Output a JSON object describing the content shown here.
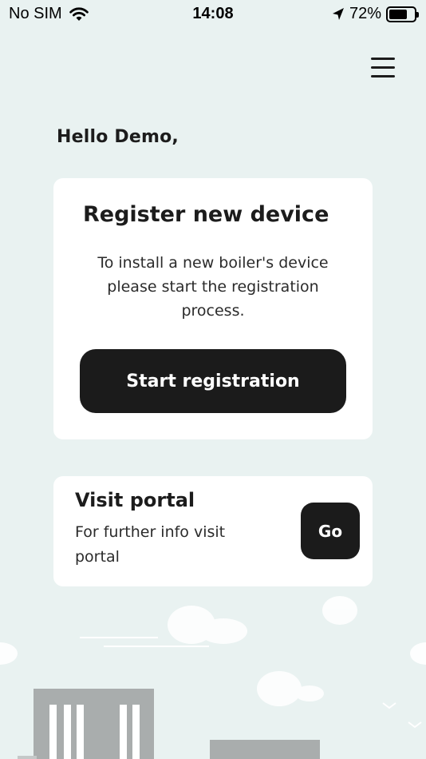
{
  "status_bar": {
    "carrier": "No SIM",
    "time": "14:08",
    "battery_percent": "72%",
    "battery_level": 0.72,
    "icons": [
      "wifi-icon",
      "location-arrow-icon",
      "battery-icon"
    ]
  },
  "header": {
    "menu_icon": "hamburger-menu-icon"
  },
  "greeting": "Hello Demo,",
  "register_card": {
    "title": "Register new device",
    "description": "To install a new boiler's device please start the registration process.",
    "button_label": "Start registration"
  },
  "portal_card": {
    "title": "Visit portal",
    "description": "For further info visit portal",
    "button_label": "Go"
  },
  "colors": {
    "background": "#e9f2f1",
    "card": "#ffffff",
    "button": "#1b1b1b",
    "button_text": "#ffffff",
    "illustration_building": "#a9adad",
    "illustration_cloud": "#ffffff"
  }
}
